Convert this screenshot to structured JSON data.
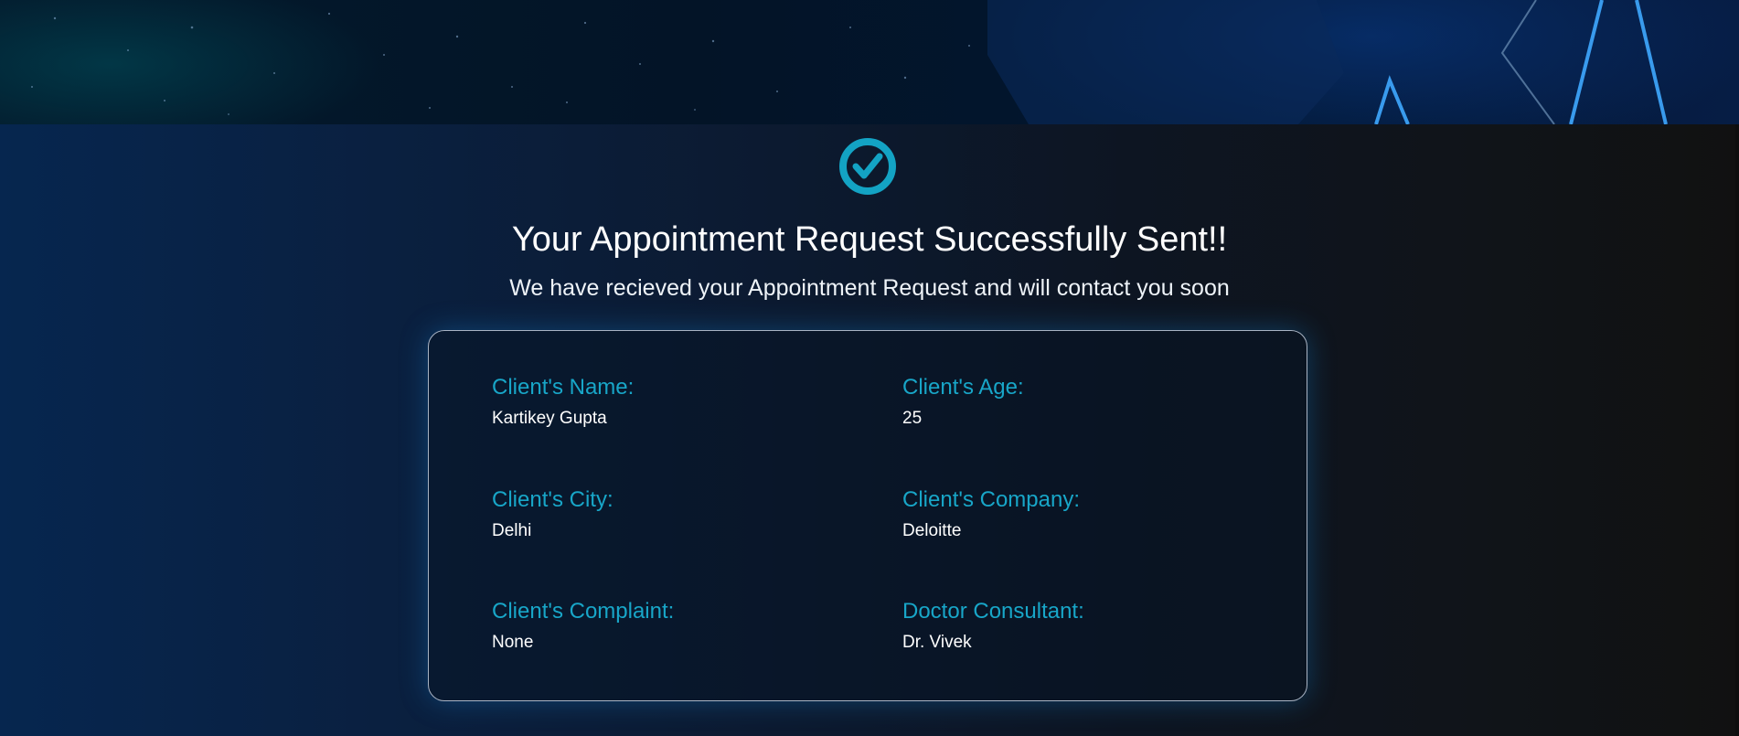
{
  "hero": {
    "icon": "check-circle-icon",
    "title": "Your Appointment Request Successfully Sent!!",
    "subtitle": "We have recieved your Appointment Request and will contact you soon"
  },
  "details": {
    "name": {
      "label": "Client's Name:",
      "value": "Kartikey Gupta"
    },
    "age": {
      "label": "Client's Age:",
      "value": "25"
    },
    "city": {
      "label": "Client's City:",
      "value": "Delhi"
    },
    "company": {
      "label": "Client's Company:",
      "value": "Deloitte"
    },
    "complaint": {
      "label": "Client's Complaint:",
      "value": "None"
    },
    "doctor": {
      "label": "Doctor Consultant:",
      "value": "Dr. Vivek"
    }
  },
  "colors": {
    "accent": "#18a6c8",
    "text": "#ffffff"
  }
}
